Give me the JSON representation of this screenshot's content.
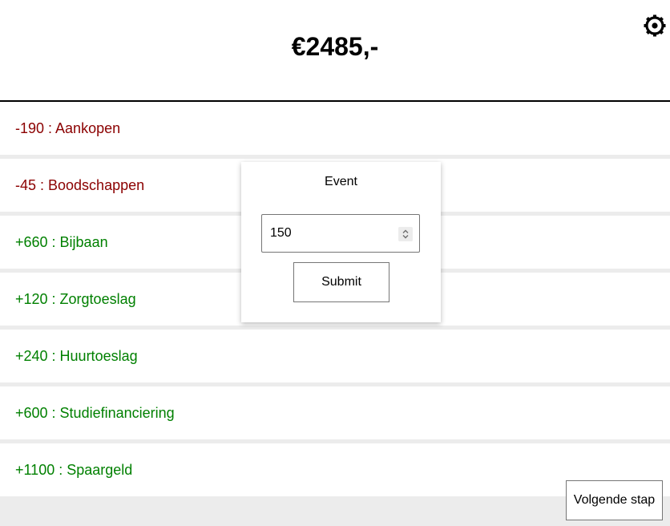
{
  "header": {
    "balance": "€2485,-",
    "settings_icon": "gear-icon"
  },
  "events": [
    {
      "label": "-190 : Aankopen",
      "kind": "negative"
    },
    {
      "label": "-45 : Boodschappen",
      "kind": "negative"
    },
    {
      "label": "+660 : Bijbaan",
      "kind": "positive"
    },
    {
      "label": "+120 : Zorgtoeslag",
      "kind": "positive"
    },
    {
      "label": "+240 : Huurtoeslag",
      "kind": "positive"
    },
    {
      "label": "+600 : Studiefinanciering",
      "kind": "positive"
    },
    {
      "label": "+1100 : Spaargeld",
      "kind": "positive"
    }
  ],
  "modal": {
    "title": "Event",
    "amount_value": "150",
    "spinner_icon": "number-spinner-icon",
    "submit_label": "Submit"
  },
  "footer": {
    "next_label": "Volgende stap"
  },
  "colors": {
    "negative": "#8b0000",
    "positive": "#008000",
    "background": "#ececec"
  }
}
